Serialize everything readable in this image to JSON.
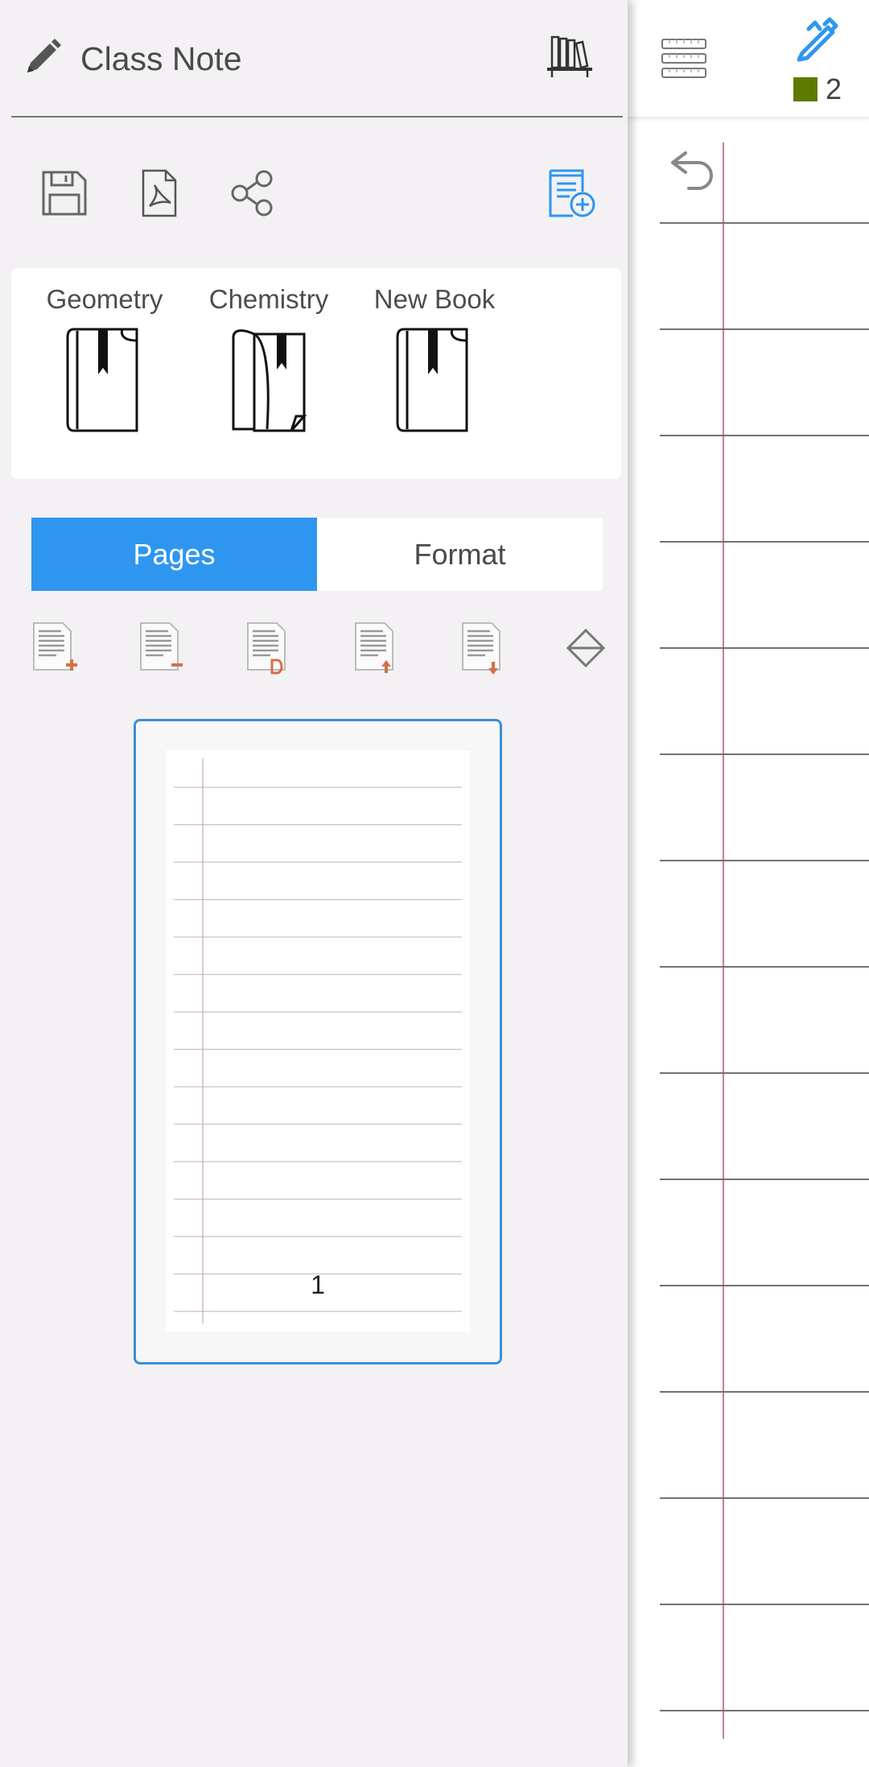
{
  "drawer": {
    "title": "Class Note",
    "books": [
      {
        "name": "Geometry",
        "icon": "closed-book-icon"
      },
      {
        "name": "Chemistry",
        "icon": "open-book-icon"
      },
      {
        "name": "New Book",
        "icon": "closed-book-icon"
      }
    ],
    "tabs": [
      {
        "label": "Pages",
        "active": true
      },
      {
        "label": "Format",
        "active": false
      }
    ],
    "page_tools": [
      "add-page-icon",
      "delete-page-icon",
      "duplicate-page-icon",
      "move-page-up-icon",
      "move-page-down-icon",
      "expand-icon"
    ],
    "pages": [
      {
        "number": "1",
        "selected": true
      }
    ]
  },
  "note_toolbar": {
    "pen_size": "2",
    "pen_color": "#5f7a00"
  },
  "colors": {
    "accent": "#2f96f0",
    "drawer_background": "#f3f1f3",
    "paper_line": "#444444",
    "margin_line": "#a05060",
    "tool_arrow": "#d4704a"
  }
}
